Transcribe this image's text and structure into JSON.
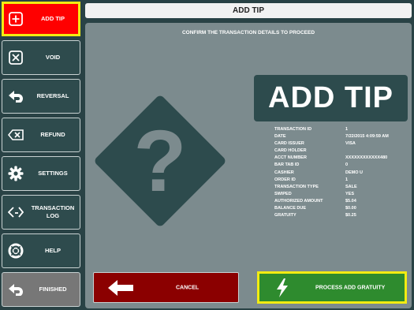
{
  "sidebar": {
    "items": [
      {
        "label": "ADD TIP",
        "icon": "plus-box-icon"
      },
      {
        "label": "VOID",
        "icon": "x-box-icon"
      },
      {
        "label": "REVERSAL",
        "icon": "undo-arrow-icon"
      },
      {
        "label": "REFUND",
        "icon": "backspace-icon"
      },
      {
        "label": "SETTINGS",
        "icon": "gear-icon"
      },
      {
        "label": "TRANSACTION LOG",
        "icon": "code-brackets-icon"
      },
      {
        "label": "HELP",
        "icon": "lifebuoy-icon"
      },
      {
        "label": "FINISHED",
        "icon": "undo-arrow-icon"
      }
    ]
  },
  "header": {
    "title": "ADD TIP"
  },
  "main": {
    "instruction": "CONFIRM THE TRANSACTION DETAILS TO PROCEED",
    "badge": "ADD TIP",
    "question_icon": "?",
    "details": [
      {
        "label": "TRANSACTION ID",
        "value": "1"
      },
      {
        "label": "DATE",
        "value": "7/22/2015 4:09:59 AM"
      },
      {
        "label": "CARD ISSUER",
        "value": "VISA"
      },
      {
        "label": "CARD HOLDER",
        "value": ""
      },
      {
        "label": "ACCT NUMBER",
        "value": "XXXXXXXXXXXX480"
      },
      {
        "label": "BAR TAB ID",
        "value": "0"
      },
      {
        "label": "CASHIER",
        "value": "DEMO U"
      },
      {
        "label": "ORDER ID",
        "value": "1"
      },
      {
        "label": "TRANSACTION TYPE",
        "value": "SALE"
      },
      {
        "label": "SWIPED",
        "value": "YES"
      },
      {
        "label": "AUTHORIZED AMOUNT",
        "value": "$5.04"
      },
      {
        "label": "BALANCE DUE",
        "value": "$0.00"
      },
      {
        "label": "GRATUITY",
        "value": "$0.25"
      }
    ]
  },
  "actions": {
    "cancel_label": "CANCEL",
    "process_label": "PROCESS ADD GRATUITY"
  },
  "colors": {
    "active": "#ff0000",
    "highlight": "#f2ec12",
    "cancel": "#8b0000",
    "process": "#2e8b2e",
    "panel": "#7c8b8e",
    "dark": "#2d4b4d"
  }
}
